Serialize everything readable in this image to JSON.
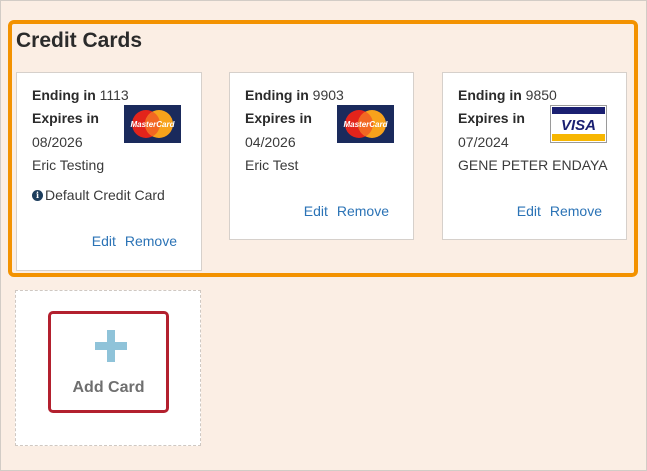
{
  "section": {
    "title": "Credit Cards"
  },
  "cards": [
    {
      "ending_label": "Ending in",
      "ending_value": "1113",
      "expires_label": "Expires in",
      "expiry": "08/2026",
      "holder": "Eric Testing",
      "brand": "MasterCard",
      "default_note": "Default Credit Card",
      "edit_label": "Edit",
      "remove_label": "Remove"
    },
    {
      "ending_label": "Ending in",
      "ending_value": "9903",
      "expires_label": "Expires in",
      "expiry": "04/2026",
      "holder": "Eric Test",
      "brand": "MasterCard",
      "edit_label": "Edit",
      "remove_label": "Remove"
    },
    {
      "ending_label": "Ending in",
      "ending_value": "9850",
      "expires_label": "Expires in",
      "expiry": "07/2024",
      "holder": "GENE PETER ENDAYA",
      "brand": "VISA",
      "edit_label": "Edit",
      "remove_label": "Remove"
    }
  ],
  "add_card": {
    "label": "Add Card",
    "icon": "plus-icon"
  },
  "colors": {
    "background": "#fbeee4",
    "highlight": "#f39200",
    "add_outline": "#b3202e",
    "link": "#2b73b6",
    "plus": "#8fc3d9"
  }
}
